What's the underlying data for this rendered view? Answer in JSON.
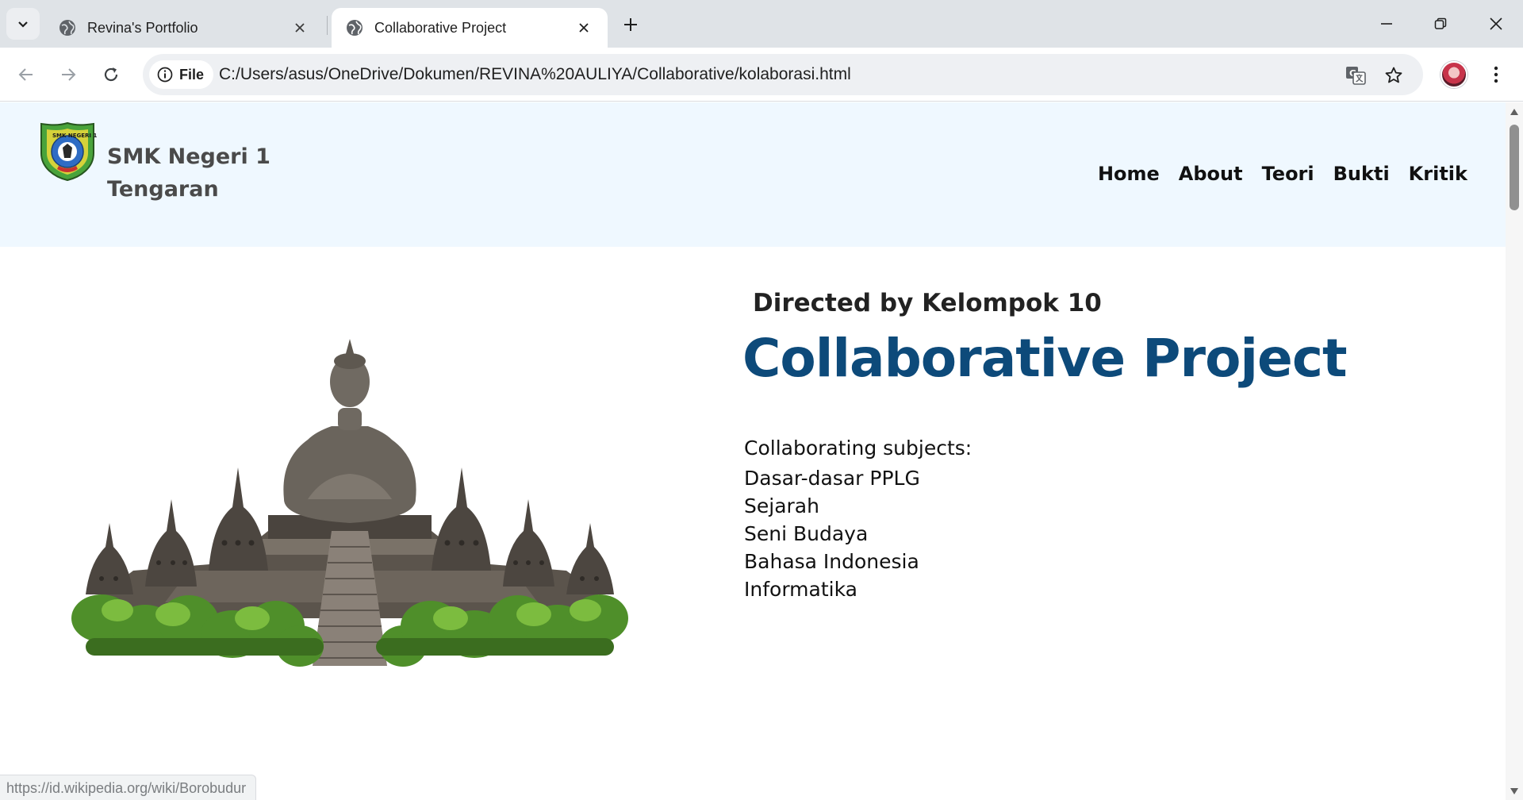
{
  "browser": {
    "tabs": [
      {
        "title": "Revina's Portfolio",
        "active": false
      },
      {
        "title": "Collaborative Project",
        "active": true
      }
    ],
    "address": {
      "chip_label": "File",
      "url": "C:/Users/asus/OneDrive/Dokumen/REVINA%20AULIYA/Collaborative/kolaborasi.html"
    },
    "status_url": "https://id.wikipedia.org/wiki/Borobudur"
  },
  "site": {
    "brand": "SMK Negeri 1 Tengaran",
    "nav": [
      "Home",
      "About",
      "Teori",
      "Bukti",
      "Kritik"
    ],
    "logo_text": "SMK NEGERI 1"
  },
  "hero": {
    "director": "Directed by Kelompok 10",
    "title": "Collaborative Project",
    "subjects_intro": "Collaborating subjects:",
    "subjects": [
      "Dasar-dasar PPLG",
      "Sejarah",
      "Seni Budaya",
      "Bahasa Indonesia",
      "Informatika"
    ]
  },
  "colors": {
    "header_bg": "#eff8ff",
    "title": "#0d4a7a",
    "tab_strip": "#dfe3e7"
  },
  "icons": {
    "favicon": "globe-icon",
    "tab_search": "chevron-down-icon",
    "translate": "translate-icon",
    "bookmark": "star-icon",
    "info": "info-icon"
  }
}
